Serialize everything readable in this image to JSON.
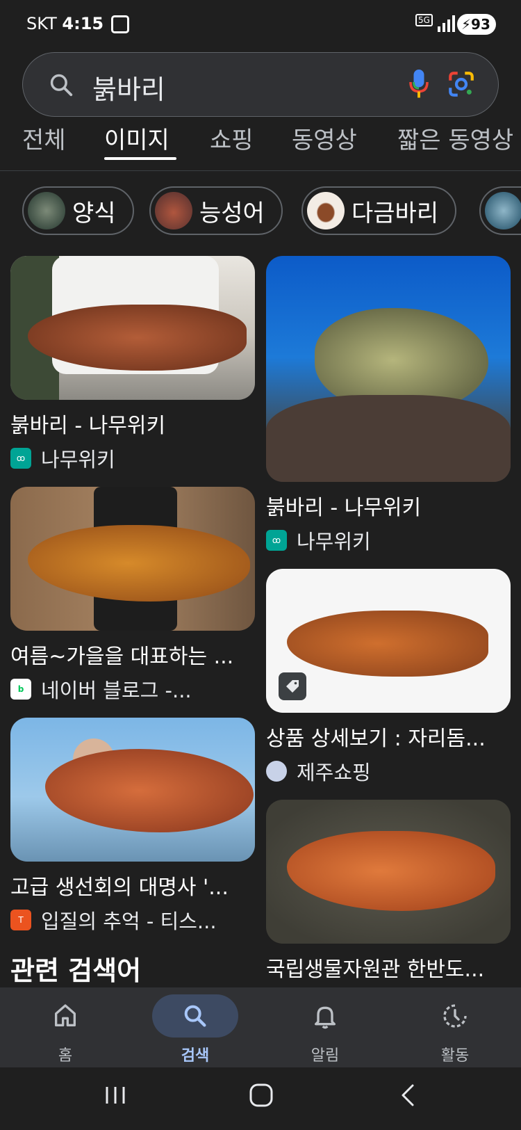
{
  "status_bar": {
    "carrier": "SKT",
    "time": "4:15",
    "network": "5G",
    "battery": "93"
  },
  "search": {
    "query": "붉바리"
  },
  "tabs": [
    {
      "label": "전체"
    },
    {
      "label": "이미지"
    },
    {
      "label": "쇼핑"
    },
    {
      "label": "동영상"
    },
    {
      "label": "짧은 동영상"
    }
  ],
  "chips": [
    {
      "label": "양식"
    },
    {
      "label": "능성어"
    },
    {
      "label": "다금바리"
    }
  ],
  "results": [
    {
      "title": "붉바리 - 나무위키",
      "source": "나무위키"
    },
    {
      "title": "붉바리 - 나무위키",
      "source": "나무위키"
    },
    {
      "title": "여름~가을을 대표하는 ...",
      "source": "네이버 블로그 -..."
    },
    {
      "title": "상품 상세보기 : 자리돔...",
      "source": "제주쇼핑"
    },
    {
      "title": "고급 생선회의 대명사 '...",
      "source": "입질의 추억 - 티스..."
    },
    {
      "title": "국립생물자원관 한반도...",
      "source": ""
    }
  ],
  "related_heading": "관련 검색어",
  "bottom_nav": [
    {
      "label": "홈"
    },
    {
      "label": "검색"
    },
    {
      "label": "알림"
    },
    {
      "label": "활동"
    }
  ],
  "colors": {
    "background": "#1f1f1f",
    "search_bg": "#303134",
    "active_nav": "#a8c7fa",
    "active_pill": "#3d4a62"
  }
}
